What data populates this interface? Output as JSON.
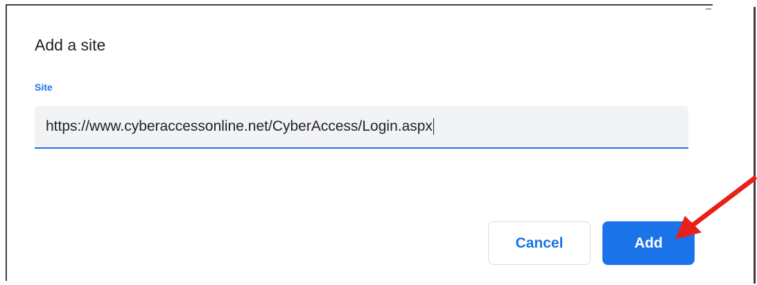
{
  "dialog": {
    "title": "Add a site",
    "site_label": "Site",
    "site_value": "https://www.cyberaccessonline.net/CyberAccess/Login.aspx"
  },
  "buttons": {
    "cancel_label": "Cancel",
    "add_label": "Add"
  },
  "colors": {
    "accent": "#1a73e8",
    "input_background": "#f1f3f4",
    "annotation_arrow": "#e8201a"
  },
  "icons": {
    "annotation": "red-arrow-icon"
  }
}
